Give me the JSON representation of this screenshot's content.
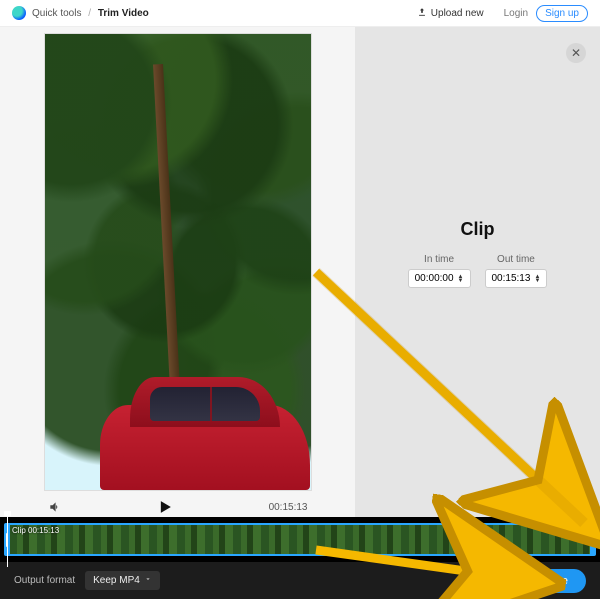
{
  "topbar": {
    "breadcrumb_root": "Quick tools",
    "breadcrumb_current": "Trim Video",
    "upload_label": "Upload new",
    "login_label": "Login",
    "signup_label": "Sign up"
  },
  "player": {
    "duration": "00:15:13"
  },
  "clip_panel": {
    "heading": "Clip",
    "in_label": "In time",
    "out_label": "Out time",
    "in_value": "00:00:00",
    "out_value": "00:15:13"
  },
  "timeline": {
    "clip_label": "Clip 00:15:13"
  },
  "bottom": {
    "output_format_label": "Output format",
    "output_format_value": "Keep MP4",
    "done_label": "Done"
  },
  "icons": {
    "upload": "upload-icon",
    "close": "close-icon",
    "volume": "volume-icon",
    "play": "play-icon",
    "chevron": "chevron-down-icon",
    "loop": "loop-icon"
  }
}
